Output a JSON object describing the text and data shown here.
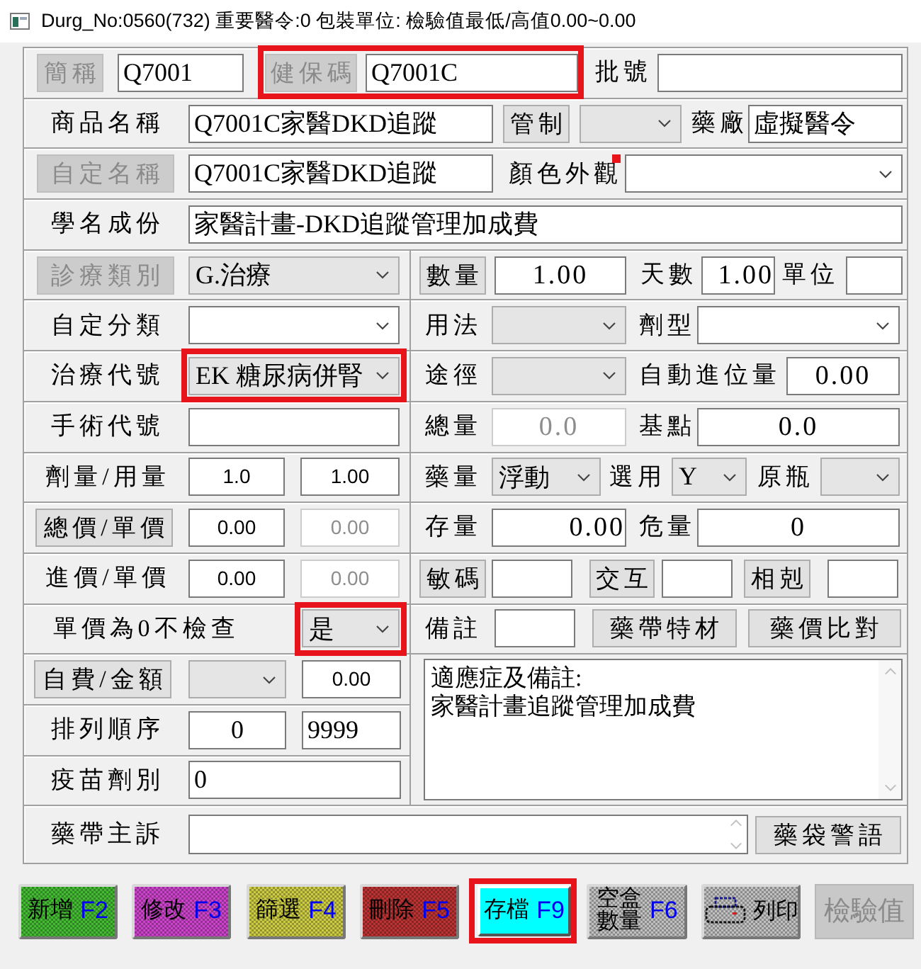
{
  "window": {
    "title": "Durg_No:0560(732) 重要醫令:0 包裝單位: 檢驗值最低/高值0.00~0.00"
  },
  "top_rows": [
    [
      {
        "kind": "button",
        "label": "簡稱",
        "disabled": true
      },
      {
        "kind": "input",
        "value": "Q7001",
        "disabled": false
      },
      {
        "kind": "highlight",
        "items": [
          {
            "kind": "button",
            "label": "健保碼",
            "disabled": true
          },
          {
            "kind": "input",
            "value": "Q7001C",
            "disabled": false
          }
        ]
      },
      {
        "kind": "label",
        "text": "批號"
      },
      {
        "kind": "input",
        "disabled": false
      }
    ],
    [
      {
        "kind": "label",
        "text": "商品名稱"
      },
      {
        "kind": "input",
        "value": "Q7001C家醫DKD追蹤",
        "disabled": false
      },
      {
        "kind": "button",
        "label": "管制",
        "disabled": false
      },
      {
        "kind": "select",
        "editable": false
      },
      {
        "kind": "label",
        "text": "藥廠"
      },
      {
        "kind": "input",
        "value": "虛擬醫令",
        "disabled": false
      }
    ],
    [
      {
        "kind": "button",
        "label": "自定名稱",
        "disabled": true
      },
      {
        "kind": "input",
        "value": "Q7001C家醫DKD追蹤",
        "disabled": false
      },
      {
        "kind": "label",
        "text": "顏色外觀"
      },
      {
        "kind": "marker"
      },
      {
        "kind": "select",
        "editable": true
      }
    ],
    [
      {
        "kind": "label",
        "text": "學名成份"
      },
      {
        "kind": "input",
        "value": "家醫計畫-DKD追蹤管理加成費",
        "disabled": false
      }
    ]
  ],
  "left_rows": [
    [
      {
        "kind": "button",
        "label": "診療類別",
        "disabled": true
      },
      {
        "kind": "select",
        "value": "G.治療",
        "editable": false
      }
    ],
    [
      {
        "kind": "label",
        "text": "自定分類"
      },
      {
        "kind": "select",
        "editable": true
      }
    ],
    [
      {
        "kind": "label",
        "text": "治療代號"
      },
      {
        "kind": "highlight",
        "items": [
          {
            "kind": "select",
            "value": "EK 糖尿病併腎",
            "editable": false
          }
        ]
      }
    ],
    [
      {
        "kind": "label",
        "text": "手術代號"
      },
      {
        "kind": "input",
        "disabled": false
      }
    ],
    [
      {
        "kind": "label",
        "text": "劑量/用量"
      },
      {
        "kind": "input",
        "value": "1.0",
        "disabled": false
      },
      {
        "kind": "input",
        "value": "1.00",
        "disabled": false
      }
    ],
    [
      {
        "kind": "button",
        "label": "總價/單價",
        "disabled": false
      },
      {
        "kind": "input",
        "value": "0.00",
        "disabled": false
      },
      {
        "kind": "input",
        "value": "0.00",
        "disabled": true
      }
    ],
    [
      {
        "kind": "label",
        "text": "進價/單價"
      },
      {
        "kind": "input",
        "value": "0.00",
        "disabled": false
      },
      {
        "kind": "input",
        "value": "0.00",
        "disabled": true
      }
    ],
    [
      {
        "kind": "label",
        "text": "單價為0不檢查"
      },
      {
        "kind": "highlight",
        "items": [
          {
            "kind": "select",
            "value": "是",
            "editable": false
          }
        ]
      }
    ],
    [
      {
        "kind": "button",
        "label": "自費/金額",
        "disabled": false
      },
      {
        "kind": "select",
        "editable": false
      },
      {
        "kind": "input",
        "value": "0.00",
        "disabled": false
      }
    ],
    [
      {
        "kind": "label",
        "text": "排列順序"
      },
      {
        "kind": "input",
        "value": "0",
        "disabled": false
      },
      {
        "kind": "input",
        "value": "9999",
        "disabled": false
      }
    ],
    [
      {
        "kind": "label",
        "text": "疫苗劑別"
      },
      {
        "kind": "input",
        "value": "0",
        "disabled": false
      }
    ]
  ],
  "right_rows": [
    [
      {
        "kind": "button",
        "label": "數量",
        "disabled": false
      },
      {
        "kind": "input",
        "value": "1.00",
        "disabled": false
      },
      {
        "kind": "label",
        "text": "天數"
      },
      {
        "kind": "input",
        "value": "1.00",
        "disabled": false
      },
      {
        "kind": "label",
        "text": "單位"
      },
      {
        "kind": "input",
        "disabled": false
      }
    ],
    [
      {
        "kind": "label",
        "text": "用法"
      },
      {
        "kind": "select",
        "editable": false
      },
      {
        "kind": "label",
        "text": "劑型"
      },
      {
        "kind": "select",
        "editable": true
      }
    ],
    [
      {
        "kind": "label",
        "text": "途徑"
      },
      {
        "kind": "select",
        "editable": false
      },
      {
        "kind": "label",
        "text": "自動進位量"
      },
      {
        "kind": "input",
        "value": "0.00",
        "disabled": false
      }
    ],
    [
      {
        "kind": "label",
        "text": "總量"
      },
      {
        "kind": "input",
        "value": "0.0",
        "disabled": true
      },
      {
        "kind": "label",
        "text": "基點"
      },
      {
        "kind": "input",
        "value": "0.0",
        "disabled": false
      }
    ],
    [
      {
        "kind": "label",
        "text": "藥量"
      },
      {
        "kind": "select",
        "value": "浮動",
        "editable": false
      },
      {
        "kind": "label",
        "text": "選用"
      },
      {
        "kind": "select",
        "value": "Y",
        "editable": false
      },
      {
        "kind": "label",
        "text": "原瓶"
      },
      {
        "kind": "select",
        "editable": false
      }
    ],
    [
      {
        "kind": "label",
        "text": "存量"
      },
      {
        "kind": "input",
        "value": "0.00",
        "disabled": false
      },
      {
        "kind": "label",
        "text": "危量"
      },
      {
        "kind": "input",
        "value": "0",
        "disabled": false
      }
    ],
    [
      {
        "kind": "button",
        "label": "敏碼",
        "disabled": false
      },
      {
        "kind": "input",
        "disabled": false
      },
      {
        "kind": "button",
        "label": "交互",
        "disabled": false
      },
      {
        "kind": "input",
        "disabled": false
      },
      {
        "kind": "button",
        "label": "相剋",
        "disabled": false
      },
      {
        "kind": "input",
        "disabled": false
      }
    ],
    [
      {
        "kind": "label",
        "text": "備註"
      },
      {
        "kind": "input",
        "disabled": false
      },
      {
        "kind": "button",
        "label": "藥帶特材",
        "disabled": false
      },
      {
        "kind": "button",
        "label": "藥價比對",
        "disabled": false
      }
    ]
  ],
  "notes": {
    "lines": [
      "適應症及備註:",
      "家醫計畫追蹤管理加成費"
    ]
  },
  "bottom_row": [
    {
      "kind": "label",
      "text": "藥帶主訴"
    },
    {
      "kind": "memo"
    },
    {
      "kind": "button",
      "label": "藥袋警語",
      "disabled": false
    }
  ],
  "footer_buttons": [
    {
      "kind": "fkey",
      "label": "新增",
      "key": "F2",
      "color": "#44bb33",
      "disabled": true
    },
    {
      "kind": "fkey",
      "label": "修改",
      "key": "F3",
      "color": "#cc44cc",
      "disabled": true
    },
    {
      "kind": "fkey",
      "label": "篩選",
      "key": "F4",
      "color": "#cccc44",
      "disabled": true
    },
    {
      "kind": "fkey",
      "label": "刪除",
      "key": "F5",
      "color": "#bb3333",
      "disabled": true
    },
    {
      "kind": "highlight",
      "items": [
        {
          "kind": "fkey",
          "label": "存檔",
          "key": "F9",
          "color": "#00ffff",
          "disabled": false
        }
      ]
    },
    {
      "kind": "fkey",
      "label": "空盒數量",
      "key": "F6",
      "color": "#c0c0c0",
      "disabled": true
    },
    {
      "kind": "print",
      "label": "列印",
      "color": "#c0c0c0",
      "disabled": true
    },
    {
      "kind": "plain",
      "label": "檢驗值",
      "color": "#c8c8c8",
      "disabled": true
    }
  ]
}
